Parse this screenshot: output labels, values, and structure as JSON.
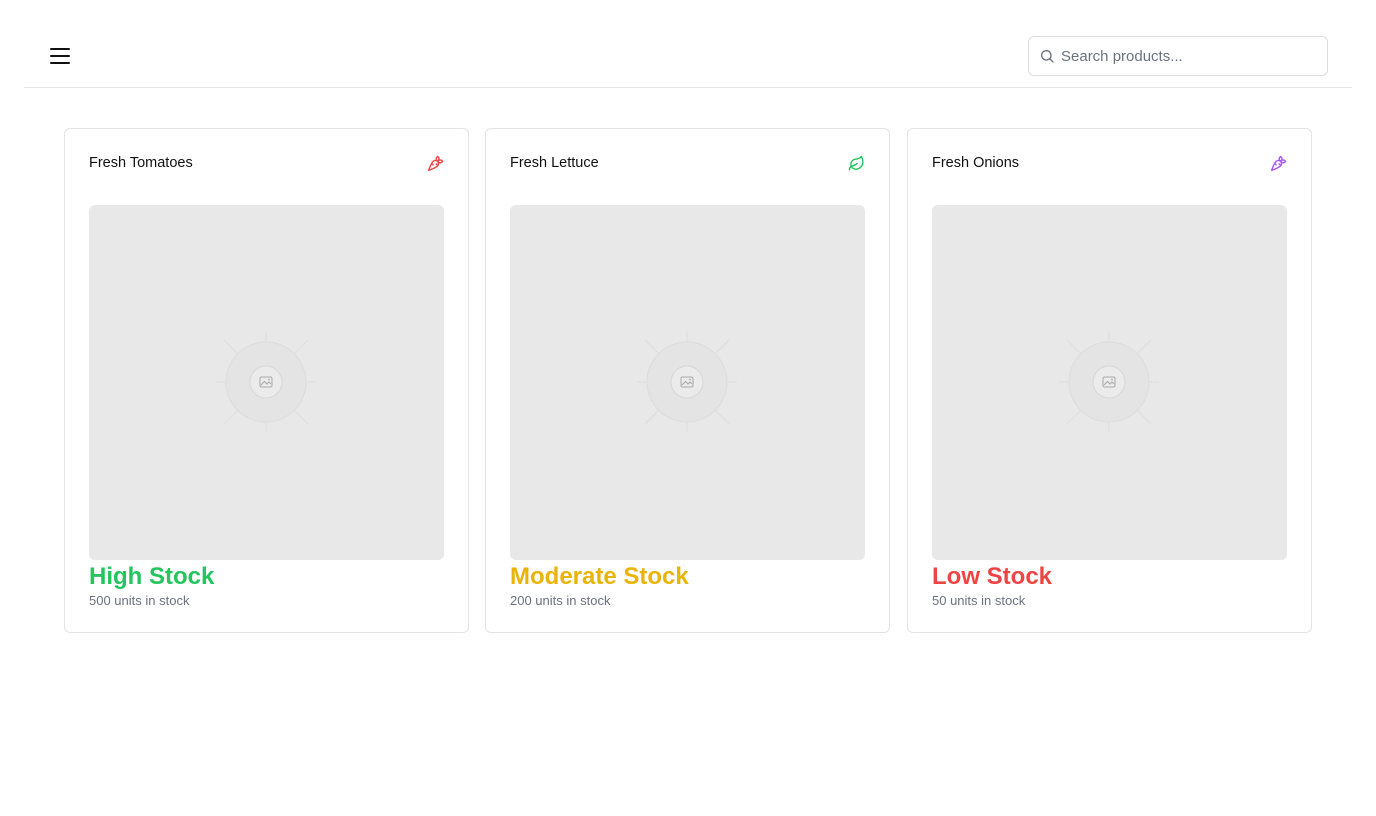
{
  "header": {
    "menu_icon": "hamburger-menu-icon",
    "search": {
      "icon": "search-icon",
      "placeholder": "Search products...",
      "value": ""
    }
  },
  "products": [
    {
      "name": "Fresh Tomatoes",
      "icon": "carrot-icon",
      "icon_color": "#ef4444",
      "stock_label": "High Stock",
      "stock_color": "#22c55e",
      "units_text": "500 units in stock",
      "image": "image-placeholder-icon"
    },
    {
      "name": "Fresh Lettuce",
      "icon": "leaf-icon",
      "icon_color": "#22c55e",
      "stock_label": "Moderate Stock",
      "stock_color": "#eab308",
      "units_text": "200 units in stock",
      "image": "image-placeholder-icon"
    },
    {
      "name": "Fresh Onions",
      "icon": "carrot-icon",
      "icon_color": "#a855f7",
      "stock_label": "Low Stock",
      "stock_color": "#ef4444",
      "units_text": "50 units in stock",
      "image": "image-placeholder-icon"
    }
  ]
}
